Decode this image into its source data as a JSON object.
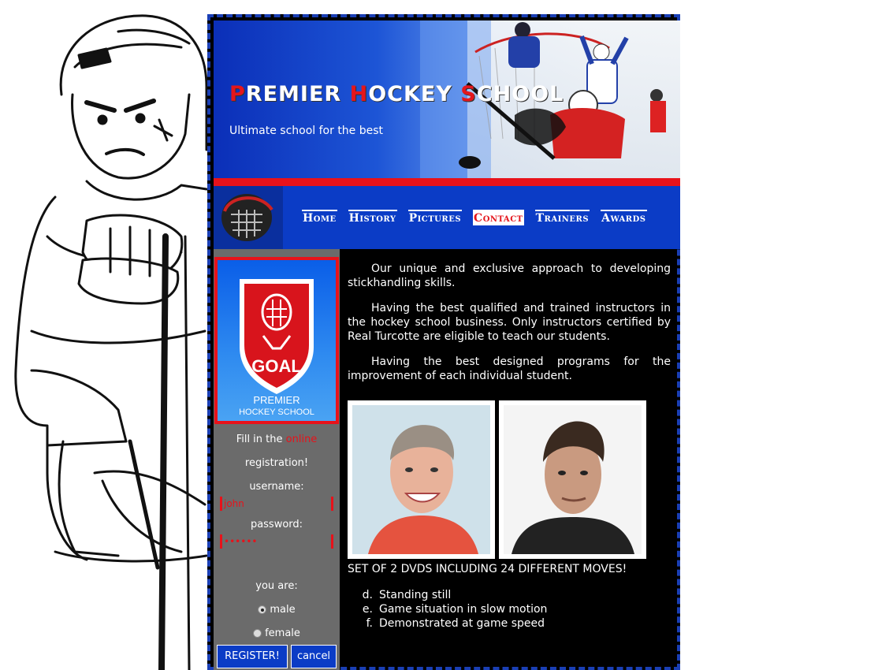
{
  "header": {
    "title_letters": [
      {
        "text": "P",
        "accent": true
      },
      {
        "text": "REMIER ",
        "accent": false
      },
      {
        "text": "H",
        "accent": true
      },
      {
        "text": "OCKEY ",
        "accent": false
      },
      {
        "text": "S",
        "accent": true
      },
      {
        "text": "CHOOL",
        "accent": false
      }
    ],
    "tagline": "Ultimate school for the best"
  },
  "nav": {
    "items": [
      {
        "label": "Home",
        "active": false
      },
      {
        "label": "History",
        "active": false
      },
      {
        "label": "Pictures",
        "active": false
      },
      {
        "label": "Contact",
        "active": true
      },
      {
        "label": "Trainers",
        "active": false
      },
      {
        "label": "Awards",
        "active": false
      }
    ]
  },
  "sidebar": {
    "badge": {
      "text": "GOAL",
      "line1": "PREMIER",
      "line2": "HOCKEY SCHOOL"
    },
    "intro_prefix": "Fill in the",
    "intro_highlight": "online",
    "intro_suffix": "registration!",
    "username_label": "username:",
    "username_value": "john",
    "password_label": "password:",
    "password_value": "••••••",
    "gender_label": "you are:",
    "gender_options": [
      {
        "label": "male",
        "checked": true
      },
      {
        "label": "female",
        "checked": false
      }
    ],
    "register_label": "REGISTER!",
    "cancel_label": "cancel"
  },
  "content": {
    "paragraphs": [
      "Our unique and exclusive approach to developing stickhandling skills.",
      "Having the best qualified and trained instructors in the hockey school business. Only instructors certified by Real Turcotte are eligible to teach our students.",
      "Having the best designed programs for the improvement of each individual student."
    ],
    "dvd_line": "SET OF 2 DVDS INCLUDING 24 DIFFERENT MOVES!",
    "list": [
      {
        "marker": "d.",
        "text": "Standing still"
      },
      {
        "marker": "e.",
        "text": "Game situation in slow motion"
      },
      {
        "marker": "f.",
        "text": "Demonstrated at game speed"
      }
    ]
  },
  "colors": {
    "brand_blue": "#0b3cc6",
    "accent_red": "#e8121a",
    "sidebar_gray": "#6b6b6b",
    "content_bg": "#000000"
  }
}
